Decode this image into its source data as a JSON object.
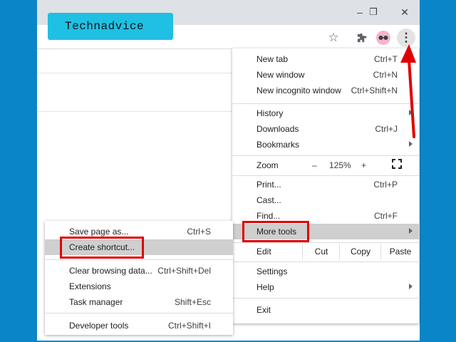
{
  "logo": {
    "text": "Technadvice"
  },
  "window_controls": {
    "minimize": "–",
    "restore": "❐",
    "close": "✕"
  },
  "toolbar": {
    "star": "☆",
    "extensions": "✦",
    "menu": "⋮"
  },
  "main_menu": {
    "new_tab": {
      "label": "New tab",
      "shortcut": "Ctrl+T"
    },
    "new_window": {
      "label": "New window",
      "shortcut": "Ctrl+N"
    },
    "new_incognito": {
      "label": "New incognito window",
      "shortcut": "Ctrl+Shift+N"
    },
    "history": {
      "label": "History"
    },
    "downloads": {
      "label": "Downloads",
      "shortcut": "Ctrl+J"
    },
    "bookmarks": {
      "label": "Bookmarks"
    },
    "zoom": {
      "label": "Zoom",
      "minus": "–",
      "value": "125%",
      "plus": "+"
    },
    "print": {
      "label": "Print...",
      "shortcut": "Ctrl+P"
    },
    "cast": {
      "label": "Cast..."
    },
    "find": {
      "label": "Find...",
      "shortcut": "Ctrl+F"
    },
    "more_tools": {
      "label": "More tools"
    },
    "edit": {
      "label": "Edit",
      "cut": "Cut",
      "copy": "Copy",
      "paste": "Paste"
    },
    "settings": {
      "label": "Settings"
    },
    "help": {
      "label": "Help"
    },
    "exit": {
      "label": "Exit"
    }
  },
  "sub_menu": {
    "save_page": {
      "label": "Save page as...",
      "shortcut": "Ctrl+S"
    },
    "create_shortcut": {
      "label": "Create shortcut..."
    },
    "clear_data": {
      "label": "Clear browsing data...",
      "shortcut": "Ctrl+Shift+Del"
    },
    "extensions": {
      "label": "Extensions"
    },
    "task_manager": {
      "label": "Task manager",
      "shortcut": "Shift+Esc"
    },
    "developer_tools": {
      "label": "Developer tools",
      "shortcut": "Ctrl+Shift+I"
    }
  },
  "colors": {
    "background": "#0a86c8",
    "highlight_box": "#e00000",
    "logo_bg": "#1fc0e3",
    "arrow": "#e00000"
  }
}
